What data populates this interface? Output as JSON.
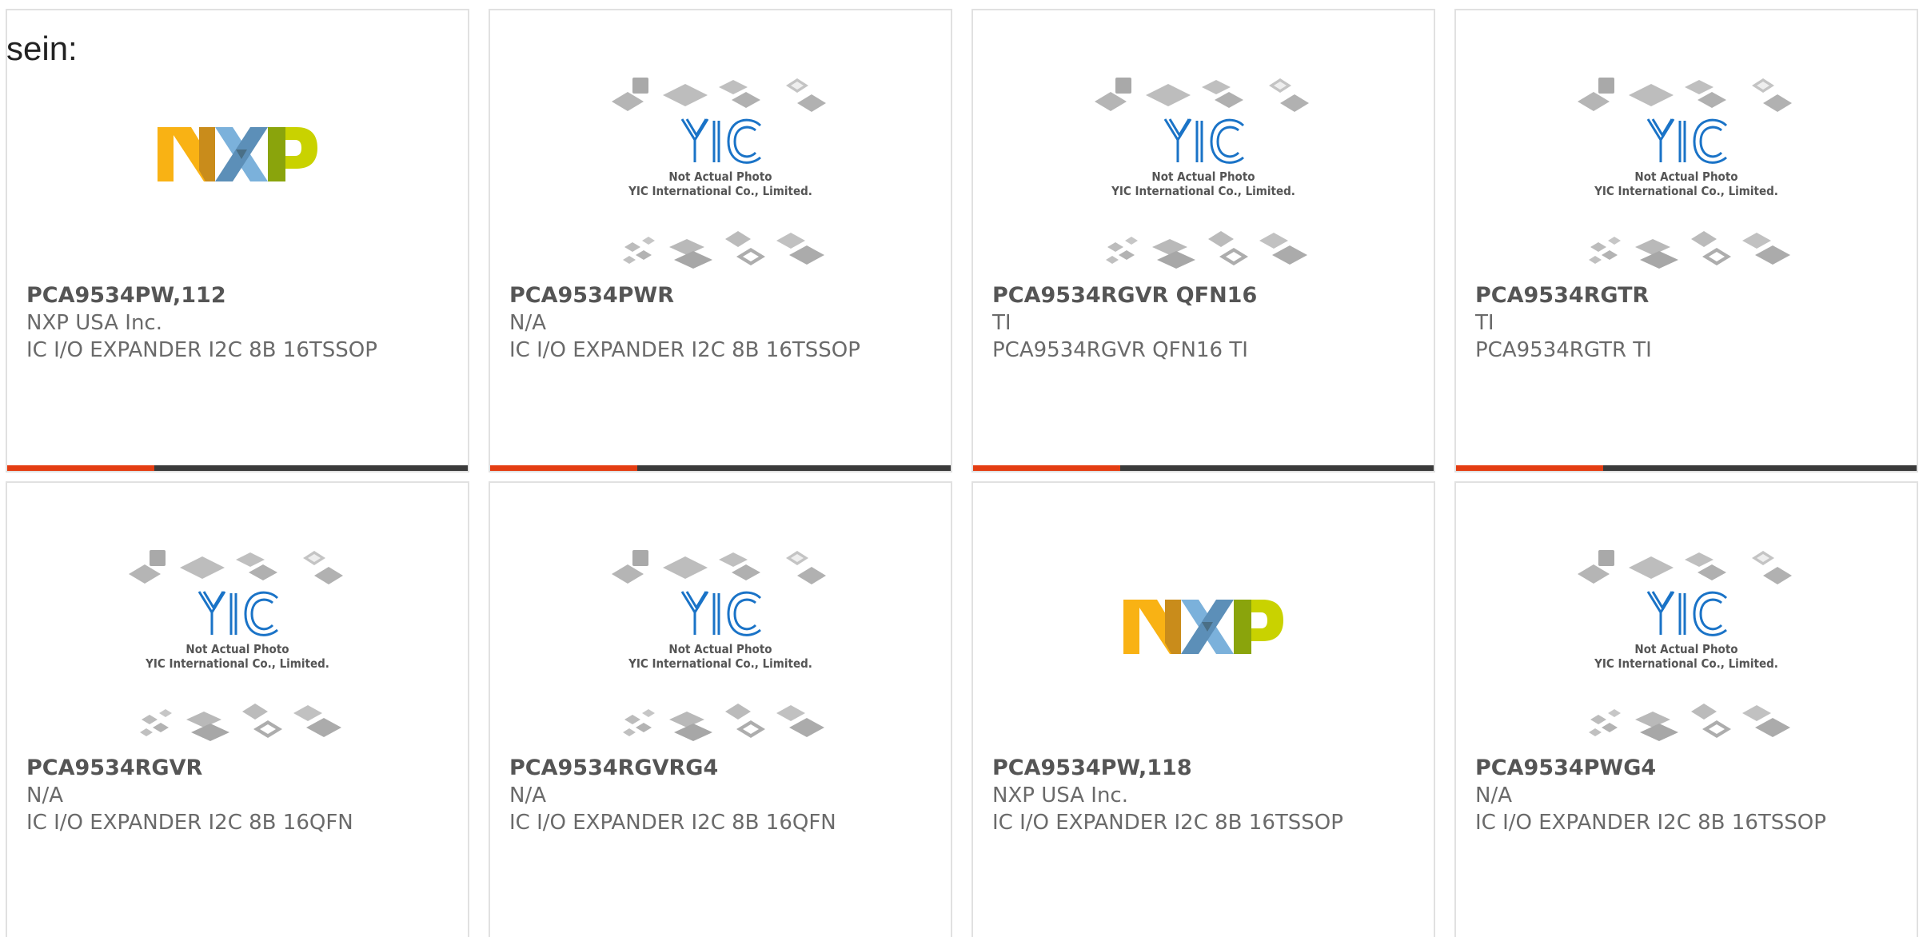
{
  "intro_text": "sein:",
  "placeholder_caption": {
    "line1": "Not Actual Photo",
    "line2": "YIC International Co., Limited."
  },
  "brand_logo_text": "NXP",
  "colors": {
    "accent": "#e43d12",
    "bar": "#3a3a3a",
    "nxp_yellow": "#f9b214",
    "nxp_blue": "#7bb1db",
    "nxp_green": "#c9d200",
    "yic_blue": "#1a73c7"
  },
  "products": [
    {
      "part": "PCA9534PW,112",
      "manufacturer": "NXP USA Inc.",
      "description": "IC I/O EXPANDER I2C 8B 16TSSOP",
      "image": "nxp-logo"
    },
    {
      "part": "PCA9534PWR",
      "manufacturer": "N/A",
      "description": "IC I/O EXPANDER I2C 8B 16TSSOP",
      "image": "yic-placeholder"
    },
    {
      "part": "PCA9534RGVR QFN16",
      "manufacturer": "TI",
      "description": "PCA9534RGVR QFN16 TI",
      "image": "yic-placeholder"
    },
    {
      "part": "PCA9534RGTR",
      "manufacturer": "TI",
      "description": "PCA9534RGTR TI",
      "image": "yic-placeholder"
    },
    {
      "part": "PCA9534RGVR",
      "manufacturer": "N/A",
      "description": "IC I/O EXPANDER I2C 8B 16QFN",
      "image": "yic-placeholder"
    },
    {
      "part": "PCA9534RGVRG4",
      "manufacturer": "N/A",
      "description": "IC I/O EXPANDER I2C 8B 16QFN",
      "image": "yic-placeholder"
    },
    {
      "part": "PCA9534PW,118",
      "manufacturer": "NXP USA Inc.",
      "description": "IC I/O EXPANDER I2C 8B 16TSSOP",
      "image": "nxp-logo"
    },
    {
      "part": "PCA9534PWG4",
      "manufacturer": "N/A",
      "description": "IC I/O EXPANDER I2C 8B 16TSSOP",
      "image": "yic-placeholder"
    }
  ]
}
